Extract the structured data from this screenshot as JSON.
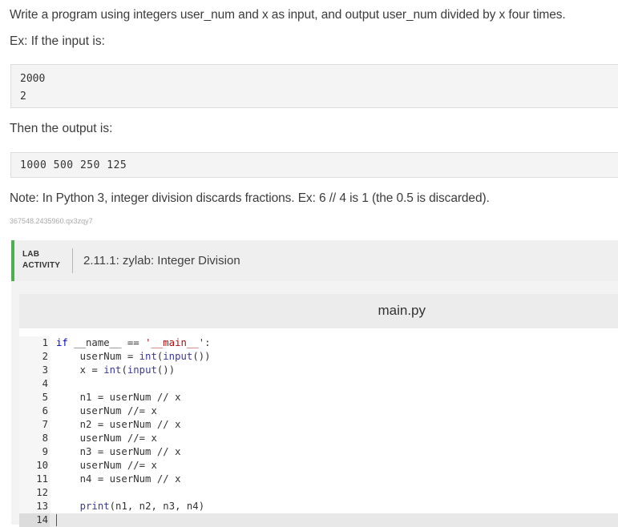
{
  "prompt": {
    "text": "Write a program using integers user_num and x as input, and output user_num divided by x four times.",
    "example_label": "Ex: If the input is:",
    "input_lines": [
      "2000",
      "2"
    ],
    "then_label": "Then the output is:",
    "output_text": "1000 500 250 125",
    "note": "Note: In Python 3, integer division discards fractions. Ex: 6 // 4 is 1 (the 0.5 is discarded).",
    "id_text": "367548.2435960.qx3zqy7"
  },
  "lab": {
    "tag_line1": "LAB",
    "tag_line2": "ACTIVITY",
    "title": "2.11.1: zylab: Integer Division"
  },
  "editor": {
    "file_name": "main.py",
    "line_numbers": [
      "1",
      "2",
      "3",
      "4",
      "5",
      "6",
      "7",
      "8",
      "9",
      "10",
      "11",
      "12",
      "13",
      "14"
    ],
    "code_lines": [
      "if __name__ == '__main__':",
      "    userNum = int(input())",
      "    x = int(input())",
      "",
      "    n1 = userNum // x",
      "    userNum //= x",
      "    n2 = userNum // x",
      "    userNum //= x",
      "    n3 = userNum // x",
      "    userNum //= x",
      "    n4 = userNum // x",
      "",
      "    print(n1, n2, n3, n4)",
      ""
    ]
  },
  "colors": {
    "accent_green": "#4caf50",
    "keyword": "#0000cc",
    "string": "#aa1111"
  }
}
